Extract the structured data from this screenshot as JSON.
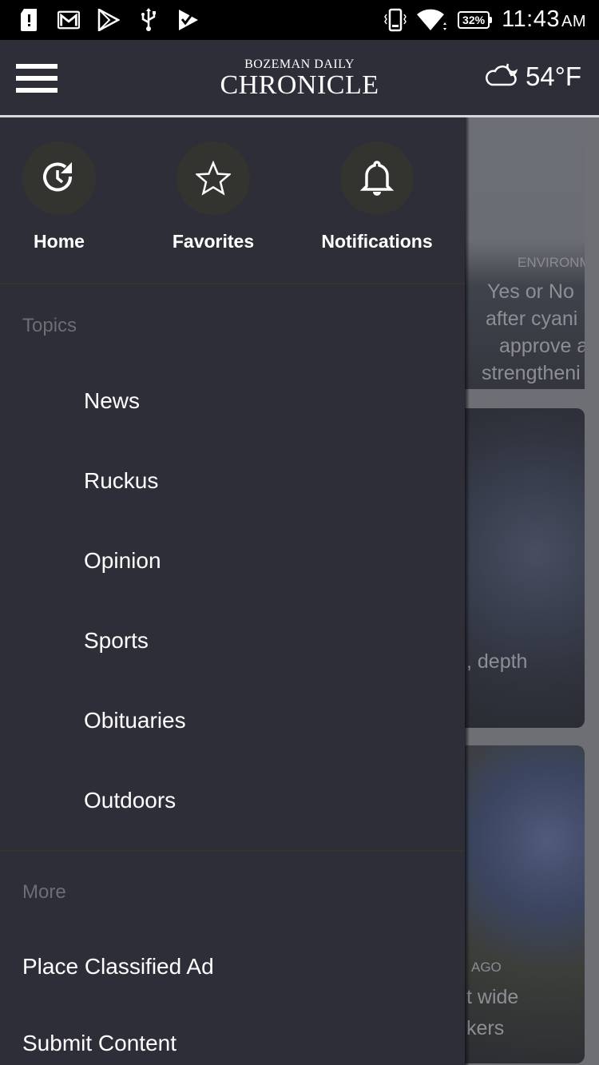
{
  "status_bar": {
    "left_icons": [
      "sim-alert-icon",
      "gmail-icon",
      "play-store-icon",
      "usb-icon",
      "task-check-icon"
    ],
    "right_icons": [
      "vibrate-icon",
      "wifi-icon"
    ],
    "battery": "32%",
    "time": "11:43",
    "ampm": "AM"
  },
  "app_bar": {
    "menu_icon": "hamburger-menu-icon",
    "masthead_small": "BOZEMAN DAILY",
    "masthead_big": "CHRONICLE",
    "weather_icon": "partly-cloudy-night-icon",
    "temperature": "54°F"
  },
  "drawer": {
    "quick_actions": [
      {
        "label": "Home",
        "icon": "home-history-icon"
      },
      {
        "label": "Favorites",
        "icon": "star-icon"
      },
      {
        "label": "Notifications",
        "icon": "bell-icon"
      }
    ],
    "topics_title": "Topics",
    "topics": [
      "News",
      "Ruckus",
      "Opinion",
      "Sports",
      "Obituaries",
      "Outdoors"
    ],
    "more_title": "More",
    "more_items": [
      "Place Classified Ad",
      "Submit Content"
    ]
  },
  "background_content": {
    "card1": {
      "kicker": "ENVIRONM",
      "lines": [
        "Yes or No",
        "after cyani",
        "approve a",
        "strengtheni"
      ]
    },
    "card2": {
      "lines": [
        ", depth"
      ]
    },
    "card3": {
      "kicker": "AGO",
      "lines": [
        "t wide",
        "kers"
      ]
    }
  },
  "colors": {
    "app_bar": "#2e2e38",
    "drawer": "#2e2e38",
    "section_title": "#6d6e74",
    "text": "#ffffff"
  }
}
